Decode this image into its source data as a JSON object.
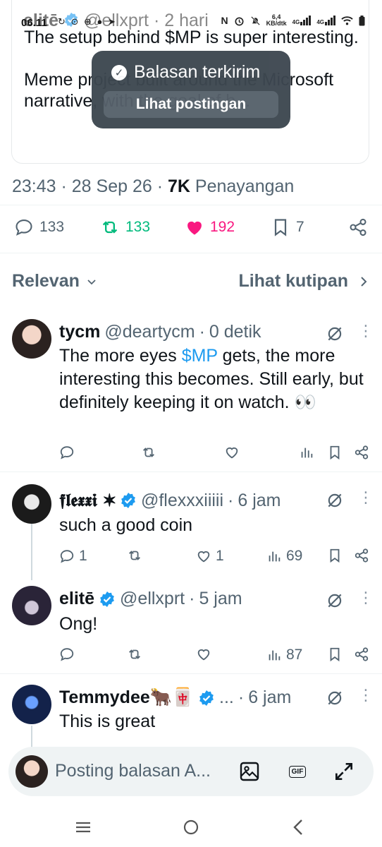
{
  "status_bar": {
    "time": "06.11",
    "left_icons": "↻ ⊙ ⊕ ● ➤",
    "net_speed_value": "6,4",
    "net_speed_unit": "KB/dtk",
    "net_label_1": "4G",
    "net_label_2": "4G",
    "icons": [
      "nfc-icon",
      "alarm-icon",
      "mute-icon",
      "signal-icon",
      "wifi-icon",
      "battery-icon"
    ]
  },
  "quoted_post": {
    "author_name": "elitē",
    "author_handle": "@ellxprt",
    "separator": "·",
    "time": "2 hari",
    "text": "The setup behind $MP is super interesting.\n\nMeme project built around the Microsoft narrative, with the goal of b..."
  },
  "toast": {
    "message": "Balasan terkirim",
    "action_label": "Lihat postingan"
  },
  "post_meta": {
    "time": "23:43",
    "date": "28 Sep 26",
    "views_count": "7K",
    "views_label": "Penayangan"
  },
  "post_actions": {
    "replies": "133",
    "reposts": "133",
    "likes": "192",
    "bookmarks": "7",
    "repost_color": "#00ba7c",
    "like_color": "#f91880"
  },
  "sort": {
    "left_label": "Relevan",
    "right_label": "Lihat kutipan"
  },
  "replies": [
    {
      "name": "tycm",
      "handle": "@deartycm",
      "time": "0 detik",
      "text_before": "The more eyes ",
      "cashtag": "$MP",
      "text_after": " gets, the more interesting this becomes. Still early, but definitely keeping it on watch. 👀",
      "replies": "",
      "reposts": "",
      "likes": "",
      "views": ""
    },
    {
      "name": "𝖋𝖑𝖊𝖝𝖝𝖎 ✶",
      "handle": "@flexxxiiiii",
      "time": "6 jam",
      "text": "such a good coin",
      "replies": "1",
      "reposts": "",
      "likes": "1",
      "views": "69"
    },
    {
      "name": "elitē",
      "handle": "@ellxprt",
      "time": "5 jam",
      "text": "Ong!",
      "replies": "",
      "reposts": "",
      "likes": "",
      "views": "87"
    },
    {
      "name": "Temmydee🐂🀄",
      "handle": "...",
      "time": "6 jam",
      "text": "This is great"
    }
  ],
  "composer": {
    "placeholder": "Posting balasan A...",
    "gif_label": "GIF"
  },
  "colors": {
    "accent": "#1d9bf0",
    "text_secondary": "#536471"
  }
}
